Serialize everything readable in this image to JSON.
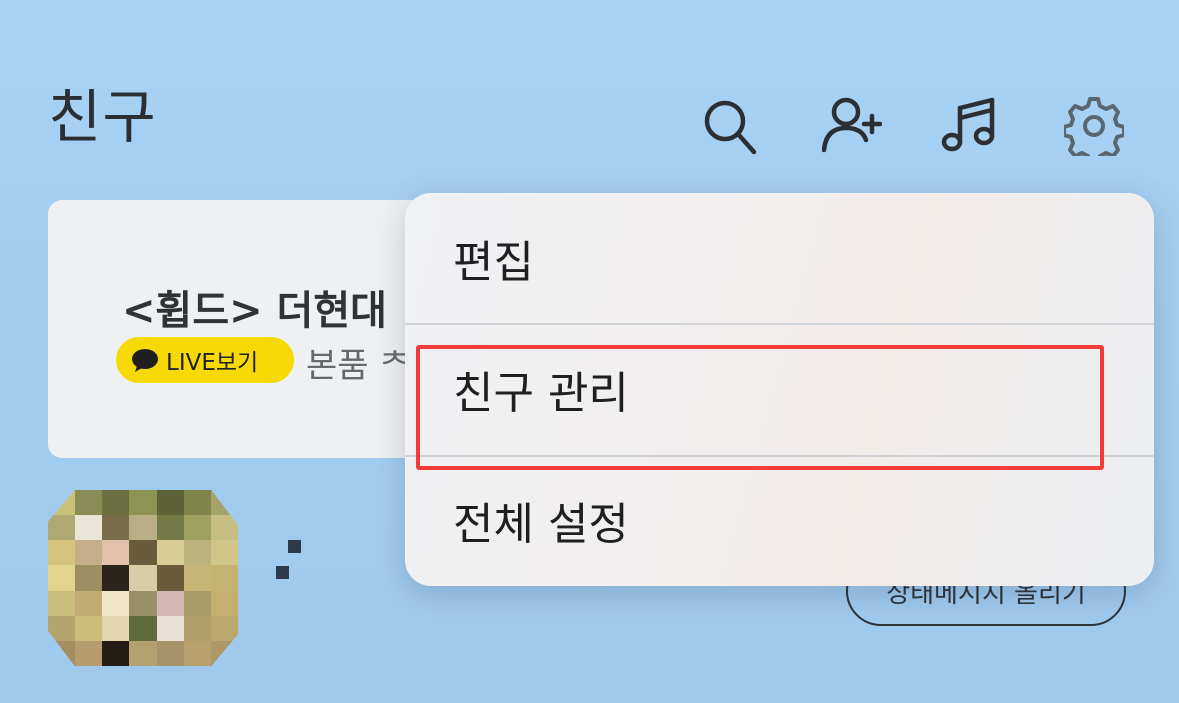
{
  "header": {
    "title": "친구",
    "icons": [
      "search-icon",
      "add-friend-icon",
      "music-icon",
      "settings-icon"
    ]
  },
  "card": {
    "title": "<휩드> 더현대",
    "badge_label": "LIVE보기",
    "subtitle": "본품 ᄎ"
  },
  "profile": {
    "status_button": "상태메시지 올리기"
  },
  "menu": {
    "items": [
      {
        "label": "편집"
      },
      {
        "label": "친구 관리"
      },
      {
        "label": "전체 설정"
      }
    ],
    "highlighted_index": 1,
    "highlight_color": "#f23c3c"
  },
  "colors": {
    "background": "#a6d0f3",
    "badge": "#f7d905"
  }
}
